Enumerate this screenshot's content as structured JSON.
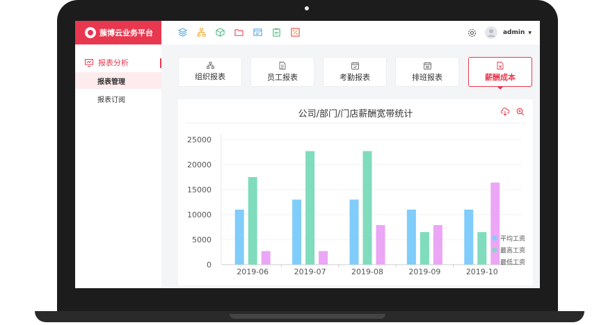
{
  "brand": {
    "name": "蔟博云业务平台"
  },
  "colors": {
    "accent": "#e8384f",
    "series": [
      "#80ccfa",
      "#7fdcbc",
      "#eba6f5"
    ]
  },
  "topbar": {
    "icons": [
      "layers-icon",
      "org-tree-icon",
      "cube-icon",
      "folder-icon",
      "window-icon",
      "clipboard-icon",
      "percent-icon"
    ],
    "user": {
      "name": "admin"
    }
  },
  "sidebar": {
    "group": "报表分析",
    "items": [
      {
        "label": "报表管理",
        "active": true
      },
      {
        "label": "报表订阅",
        "active": false
      }
    ]
  },
  "tabs": [
    {
      "label": "组织报表",
      "icon": "org-icon",
      "active": false
    },
    {
      "label": "员工报表",
      "icon": "document-icon",
      "active": false
    },
    {
      "label": "考勤报表",
      "icon": "calendar-icon",
      "active": false
    },
    {
      "label": "排班报表",
      "icon": "schedule-icon",
      "active": false
    },
    {
      "label": "薪酬成本",
      "icon": "salary-doc-icon",
      "active": true
    }
  ],
  "chart_data": {
    "type": "bar",
    "title": "公司/部门/门店薪酬宽带统计",
    "categories": [
      "2019-06",
      "2019-07",
      "2019-08",
      "2019-09",
      "2019-10"
    ],
    "series": [
      {
        "name": "平均工资",
        "values": [
          11000,
          13000,
          13000,
          11000,
          11000
        ]
      },
      {
        "name": "最高工资",
        "values": [
          17500,
          22700,
          22700,
          6500,
          6500
        ]
      },
      {
        "name": "最低工资",
        "values": [
          2700,
          2700,
          7900,
          7900,
          16400
        ]
      }
    ],
    "yticks": [
      "0",
      "5000",
      "10000",
      "15000",
      "20000",
      "25000"
    ],
    "ylim": [
      0,
      25000
    ],
    "legend_position": "bottom-right",
    "grid": true
  }
}
